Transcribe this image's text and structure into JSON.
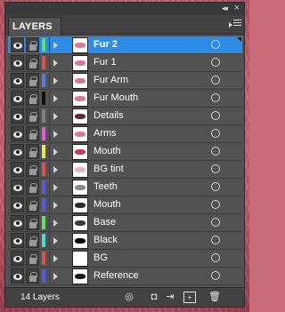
{
  "panel": {
    "tab_label": "LAYERS",
    "collapse_glyph": "◂◂",
    "close_glyph": "×",
    "layer_count": "14 Layers"
  },
  "colors": {
    "selection": "#2d8ce6",
    "panel_bg": "#535353"
  },
  "layers": [
    {
      "name": "Fur 2",
      "swatch": "#5fe35f",
      "selected": true,
      "mark_color": "#d77a96"
    },
    {
      "name": "Fur 1",
      "swatch": "#e05050",
      "selected": false,
      "mark_color": "#d77a96"
    },
    {
      "name": "Fur Arm",
      "swatch": "#5a7ae8",
      "selected": false,
      "mark_color": "#d77a96"
    },
    {
      "name": "Fur Mouth",
      "swatch": "#101010",
      "selected": false,
      "mark_color": "#d77a96"
    },
    {
      "name": "Details",
      "swatch": "#808080",
      "selected": false,
      "mark_color": "#5a3030"
    },
    {
      "name": "Arms",
      "swatch": "#e05adf",
      "selected": false,
      "mark_color": "#d77a96"
    },
    {
      "name": "Mouth",
      "swatch": "#e8e850",
      "selected": false,
      "mark_color": "#c83a5a"
    },
    {
      "name": "BG tint",
      "swatch": "#e05050",
      "selected": false,
      "mark_color": "#e8b6c2"
    },
    {
      "name": "Teeth",
      "swatch": "#5a5ae0",
      "selected": false,
      "mark_color": "#888888"
    },
    {
      "name": "Mouth",
      "swatch": "#5a5ae0",
      "selected": false,
      "mark_color": "#2a2a2a"
    },
    {
      "name": "Base",
      "swatch": "#5fe35f",
      "selected": false,
      "mark_color": "#3a3a3a"
    },
    {
      "name": "Black",
      "swatch": "#4ad8d8",
      "selected": false,
      "mark_color": "#000000"
    },
    {
      "name": "BG",
      "swatch": "#e05050",
      "selected": false,
      "mark_color": "#ffffff"
    },
    {
      "name": "Reference",
      "swatch": "#5a5ae0",
      "selected": false,
      "mark_color": "#1a1a1a"
    }
  ],
  "bottom_icons": [
    "locate-object-icon",
    "make-clipping-mask-icon",
    "create-sublayer-icon",
    "create-new-layer-icon",
    "trash-icon"
  ]
}
